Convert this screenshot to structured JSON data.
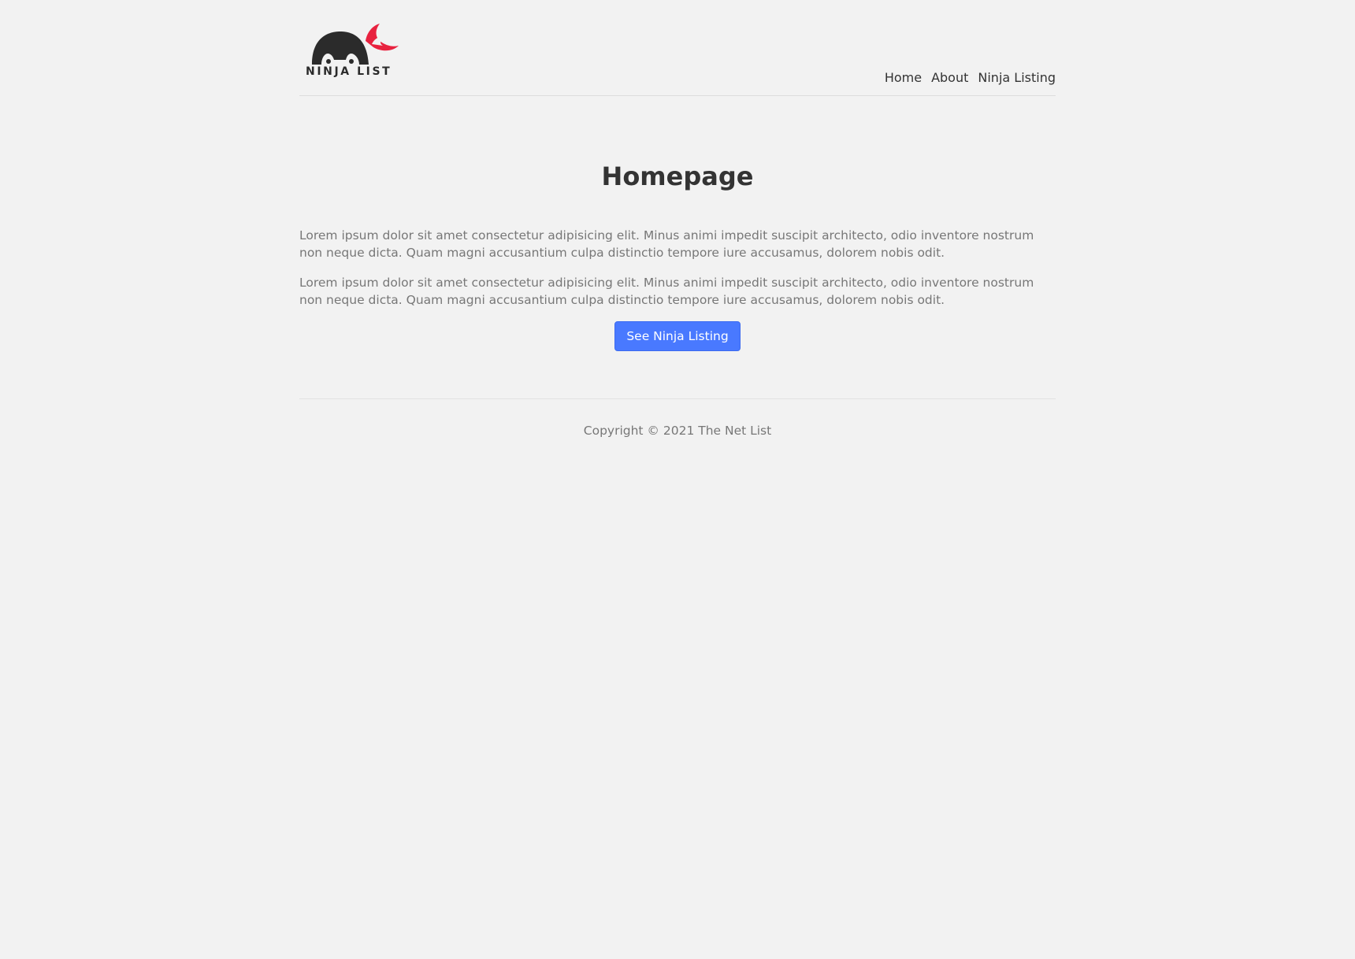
{
  "brand": {
    "logo_text": "NINJA LIST",
    "logo_icon": "ninja-head-icon",
    "colors": {
      "ninja": "#2b2b2b",
      "headband": "#e8223f"
    }
  },
  "nav": {
    "items": [
      {
        "label": "Home"
      },
      {
        "label": "About"
      },
      {
        "label": "Ninja Listing"
      }
    ]
  },
  "main": {
    "title": "Homepage",
    "paragraphs": [
      "Lorem ipsum dolor sit amet consectetur adipisicing elit. Minus animi impedit suscipit architecto, odio inventore nostrum non neque dicta. Quam magni accusantium culpa distinctio tempore iure accusamus, dolorem nobis odit.",
      "Lorem ipsum dolor sit amet consectetur adipisicing elit. Minus animi impedit suscipit architecto, odio inventore nostrum non neque dicta. Quam magni accusantium culpa distinctio tempore iure accusamus, dolorem nobis odit."
    ],
    "cta_label": "See Ninja Listing"
  },
  "footer": {
    "copyright": "Copyright © 2021 The Net List"
  },
  "theme": {
    "background": "#f2f2f2",
    "accent": "#4979ff"
  }
}
